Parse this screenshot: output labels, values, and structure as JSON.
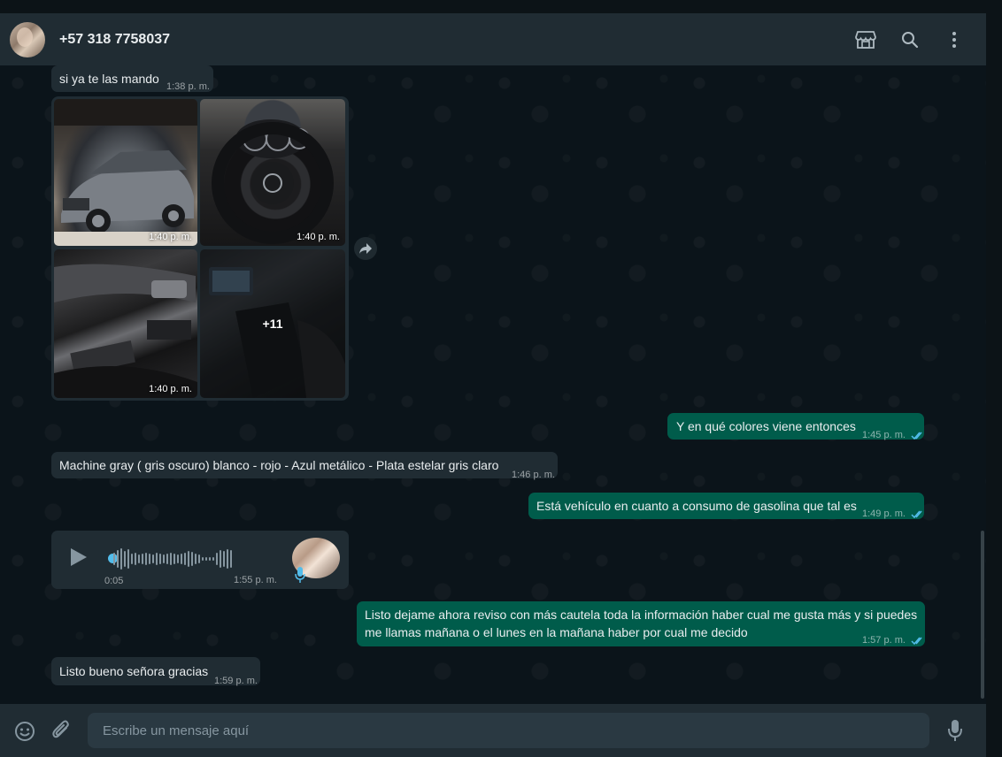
{
  "header": {
    "contact_name": "+57 318 7758037",
    "icons": [
      "shop-icon",
      "search-icon",
      "menu-dots-icon"
    ]
  },
  "messages": {
    "m1": {
      "text": "si ya te las mando",
      "time": "1:38 p. m."
    },
    "gallery": {
      "photo_times": [
        "1:40 p. m.",
        "1:40 p. m.",
        "1:40 p. m."
      ],
      "more_count": "+11"
    },
    "m2": {
      "text": "Y en qué colores viene entonces",
      "time": "1:45 p. m."
    },
    "m3": {
      "text": "Machine gray ( gris oscuro) blanco - rojo - Azul metálico - Plata estelar gris claro",
      "time": "1:46 p. m."
    },
    "m4": {
      "text": "Está vehículo en cuanto a consumo de gasolina que tal es",
      "time": "1:49 p. m."
    },
    "voice": {
      "duration": "0:05",
      "time": "1:55 p. m."
    },
    "m5": {
      "text_line1": "Listo dejame ahora reviso con más cautela toda la información haber cual me gusta más y si puedes",
      "text_line2": "me llamas mañana o el lunes en la mañana haber por cual me decido",
      "time": "1:57 p. m."
    },
    "m6": {
      "text": "Listo bueno señora gracias",
      "time": "1:59 p. m."
    }
  },
  "composer": {
    "placeholder": "Escribe un mensaje aquí",
    "icons": [
      "emoji-icon",
      "attach-icon",
      "microphone-icon"
    ]
  },
  "colors": {
    "incoming_bubble": "#202c33",
    "outgoing_bubble": "#005c4b",
    "read_ticks": "#53bdeb"
  }
}
